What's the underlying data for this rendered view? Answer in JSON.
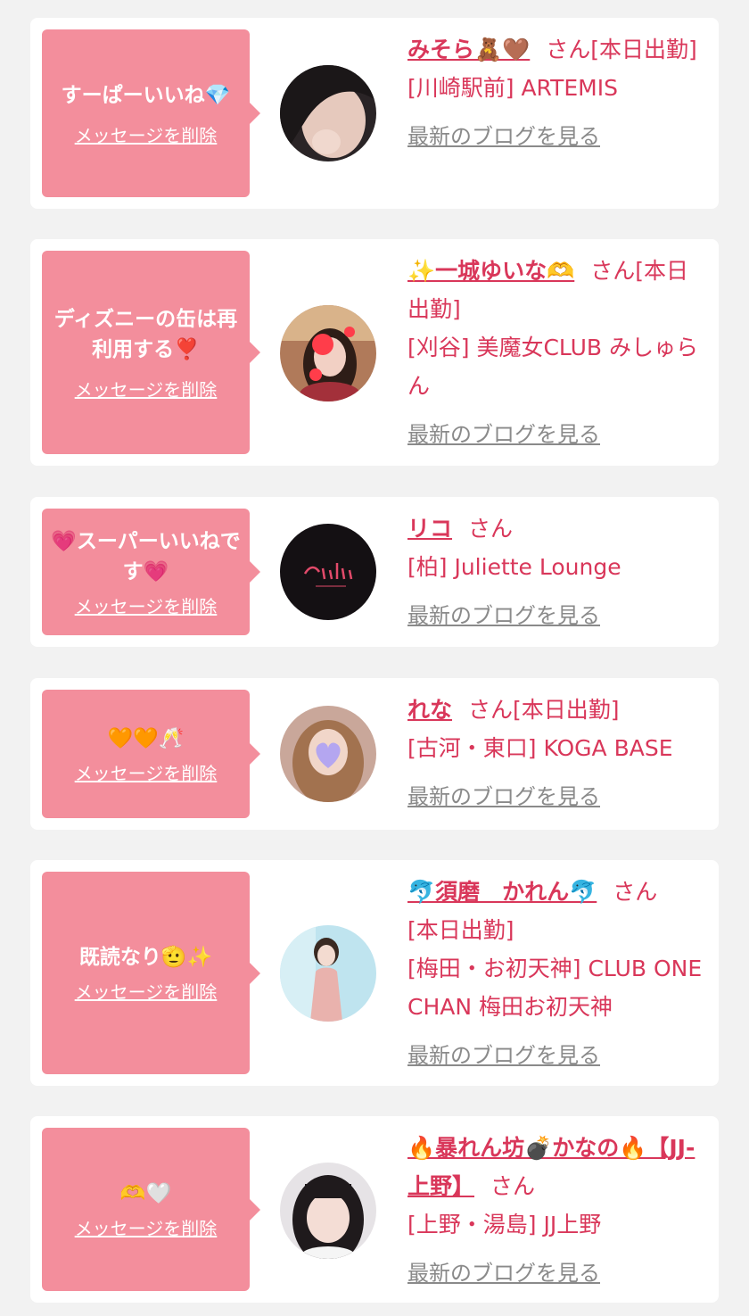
{
  "messages": [
    {
      "text": "すーぱーいいね💎",
      "delete_label": "メッセージを削除",
      "name": "みそら🧸🤎",
      "san": "さん",
      "status": "[本日出勤]",
      "shop": "[川崎駅前] ARTEMIS",
      "blog_label": "最新のブログを見る"
    },
    {
      "text": "ディズニーの缶は再利用する❣️",
      "delete_label": "メッセージを削除",
      "name": "✨一城ゆいな🫶",
      "san": "さん",
      "status": "[本日出勤]",
      "shop": "[刈谷] 美魔女CLUB みしゅらん",
      "blog_label": "最新のブログを見る"
    },
    {
      "text": "💗スーパーいいねです💗",
      "delete_label": "メッセージを削除",
      "name": "リコ",
      "san": "さん",
      "status": "",
      "shop": "[柏] Juliette Lounge",
      "blog_label": "最新のブログを見る"
    },
    {
      "text": "🧡🧡🥂",
      "delete_label": "メッセージを削除",
      "name": "れな",
      "san": "さん",
      "status": "[本日出勤]",
      "shop": "[古河・東口] KOGA BASE",
      "blog_label": "最新のブログを見る"
    },
    {
      "text": "既読なり🫡✨",
      "delete_label": "メッセージを削除",
      "name": "🐬須磨　かれん🐬",
      "san": "さん",
      "status": "[本日出勤]",
      "shop": "[梅田・お初天神] CLUB ONE CHAN 梅田お初天神",
      "blog_label": "最新のブログを見る"
    },
    {
      "text": "🫶🤍",
      "delete_label": "メッセージを削除",
      "name": "🔥暴れん坊💣かなの🔥【JJ-上野】",
      "san": "さん",
      "status": "",
      "shop": "[上野・湯島] JJ上野",
      "blog_label": "最新のブログを見る"
    }
  ],
  "colors": {
    "bubble": "#f38e9c",
    "accent": "#d9375a",
    "link_gray": "#8a8a8a",
    "page_bg": "#f2f2f2"
  }
}
